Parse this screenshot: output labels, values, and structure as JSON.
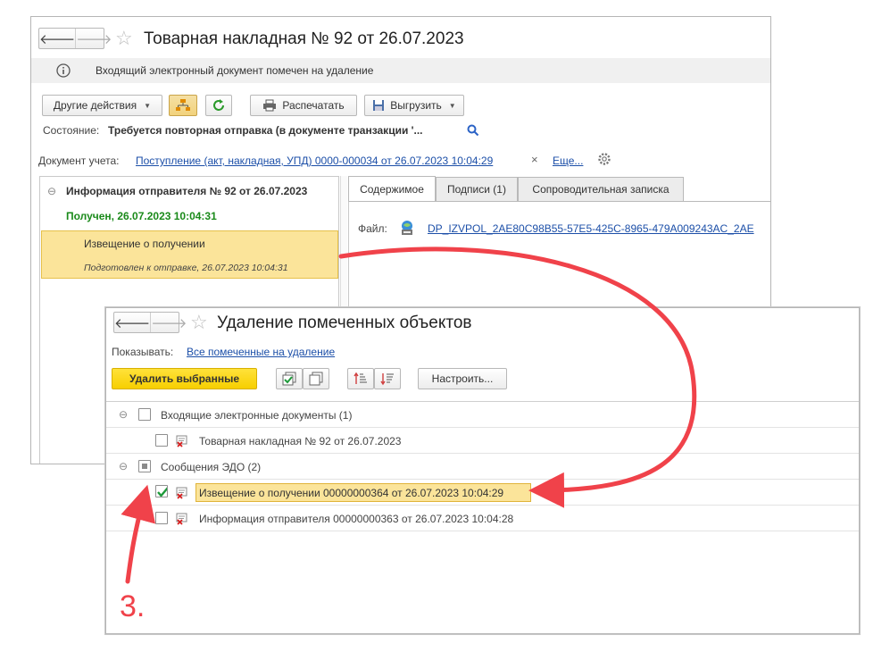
{
  "window1": {
    "title": "Товарная накладная № 92 от 26.07.2023",
    "info_message": "Входящий электронный документ помечен на удаление",
    "toolbar": {
      "other_actions": "Другие действия",
      "print": "Распечатать",
      "export": "Выгрузить"
    },
    "status_label": "Состояние:",
    "status_value": "Требуется повторная отправка (в документе транзакции '...",
    "account_doc_label": "Документ учета:",
    "account_doc_link": "Поступление (акт, накладная, УПД) 0000-000034 от 26.07.2023 10:04:29",
    "clear_symbol": "×",
    "more_link": "Еще...",
    "tree": {
      "header": "Информация отправителя № 92 от 26.07.2023",
      "received": "Получен, 26.07.2023 10:04:31",
      "item_title": "Извещение о получении",
      "item_sub": "Подготовлен к отправке, 26.07.2023 10:04:31"
    },
    "tabs": [
      "Содержимое",
      "Подписи (1)",
      "Сопроводительная записка"
    ],
    "file_label": "Файл:",
    "file_link": "DP_IZVPOL_2AE80C98B55-57E5-425C-8965-479A009243AC_2AE"
  },
  "window2": {
    "title": "Удаление помеченных объектов",
    "show_label": "Показывать:",
    "show_link": "Все помеченные на удаление",
    "delete_button": "Удалить выбранные",
    "settings_button": "Настроить...",
    "groups": [
      {
        "label": "Входящие электронные документы (1)",
        "items": [
          "Товарная накладная № 92 от 26.07.2023"
        ]
      },
      {
        "label": "Сообщения ЭДО (2)",
        "items": [
          "Извещение о получении 00000000364 от 26.07.2023 10:04:29",
          "Информация отправителя 00000000363 от 26.07.2023 10:04:28"
        ]
      }
    ]
  },
  "annotation": {
    "step": "3."
  },
  "colors": {
    "accent_yellow": "#f7cf00",
    "selection_fill": "#fbe49a",
    "received_green": "#1a8a1a",
    "link_blue": "#1c4fa8",
    "arrow_red": "#f0424a"
  },
  "icons": [
    "info-icon",
    "search-icon",
    "gear-icon",
    "refresh-icon",
    "printer-icon",
    "floppy-icon",
    "tree-structure-icon",
    "sort-asc-icon",
    "sort-desc-icon",
    "check-all-icon",
    "uncheck-all-icon",
    "doc-delete-icon",
    "file-signed-icon"
  ]
}
